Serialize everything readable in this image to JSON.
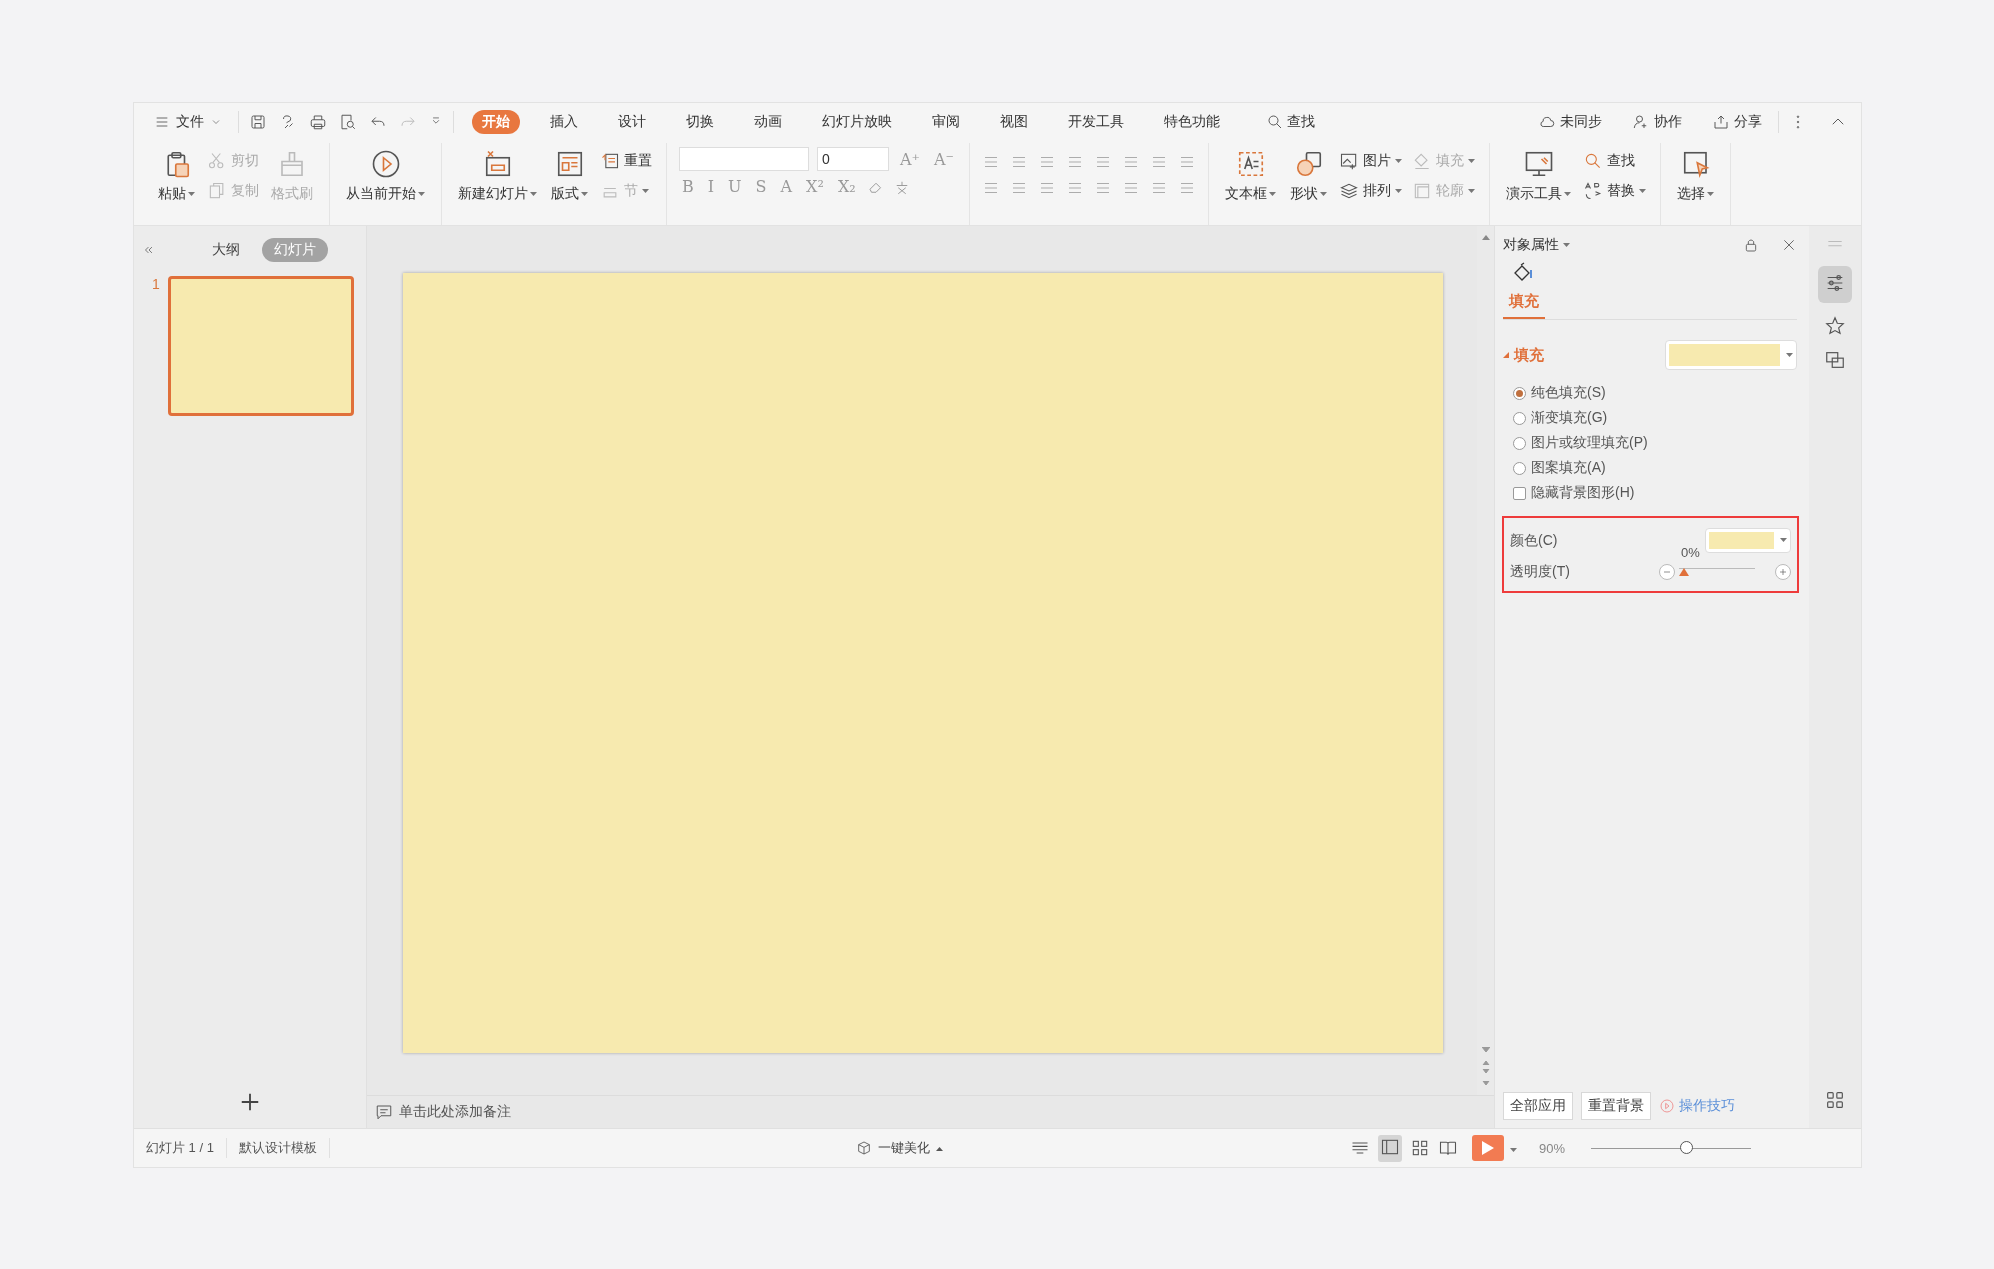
{
  "menu": {
    "label": "文件"
  },
  "tabs": [
    {
      "label": "开始",
      "selected": true
    },
    {
      "label": "插入",
      "selected": false
    },
    {
      "label": "设计",
      "selected": false
    },
    {
      "label": "切换",
      "selected": false
    },
    {
      "label": "动画",
      "selected": false
    },
    {
      "label": "幻灯片放映",
      "selected": false
    },
    {
      "label": "审阅",
      "selected": false
    },
    {
      "label": "视图",
      "selected": false
    },
    {
      "label": "开发工具",
      "selected": false
    },
    {
      "label": "特色功能",
      "selected": false
    }
  ],
  "search": {
    "label": "查找"
  },
  "top_right": [
    {
      "label": "未同步"
    },
    {
      "label": "协作"
    },
    {
      "label": "分享"
    }
  ],
  "ribbon": [
    {
      "kind": "buttons",
      "items": [
        {
          "label": "粘贴",
          "kind": "large",
          "dropdown": true,
          "disabled": false
        },
        {
          "label": "剪切",
          "kind": "small",
          "dropdown": false,
          "disabled": true
        },
        {
          "label": "复制",
          "kind": "small",
          "dropdown": false,
          "disabled": true
        },
        {
          "label": "格式刷",
          "kind": "large",
          "dropdown": false,
          "disabled": true
        }
      ]
    },
    {
      "kind": "buttons",
      "items": [
        {
          "label": "从当前开始",
          "kind": "large",
          "dropdown": true,
          "disabled": false
        }
      ]
    },
    {
      "kind": "buttons",
      "items": [
        {
          "label": "新建幻灯片",
          "kind": "large",
          "dropdown": true,
          "disabled": false
        },
        {
          "label": "版式",
          "kind": "large",
          "dropdown": true,
          "disabled": false
        },
        {
          "label": "重置",
          "kind": "small",
          "dropdown": false,
          "disabled": false
        },
        {
          "label": "节",
          "kind": "small",
          "dropdown": true,
          "disabled": true
        }
      ]
    },
    {
      "kind": "font",
      "size_value": "0",
      "grow": "A⁺",
      "shrink": "A⁻",
      "styles": [
        "B",
        "I",
        "U",
        "S",
        "A",
        "X²",
        "X₂"
      ]
    },
    {
      "kind": "paragraph"
    },
    {
      "kind": "buttons",
      "items": [
        {
          "label": "文本框",
          "kind": "large",
          "dropdown": true,
          "disabled": false
        },
        {
          "label": "形状",
          "kind": "large",
          "dropdown": true,
          "disabled": false
        },
        {
          "label": "图片",
          "kind": "small",
          "dropdown": true,
          "disabled": false
        },
        {
          "label": "排列",
          "kind": "small",
          "dropdown": true,
          "disabled": false
        },
        {
          "label": "填充",
          "kind": "small",
          "dropdown": true,
          "disabled": true
        },
        {
          "label": "轮廓",
          "kind": "small",
          "dropdown": true,
          "disabled": true
        }
      ]
    },
    {
      "kind": "buttons",
      "items": [
        {
          "label": "演示工具",
          "kind": "large",
          "dropdown": true,
          "disabled": false
        },
        {
          "label": "查找",
          "kind": "small",
          "dropdown": false,
          "disabled": false
        },
        {
          "label": "替换",
          "kind": "small",
          "dropdown": true,
          "disabled": false
        }
      ]
    },
    {
      "kind": "buttons",
      "items": [
        {
          "label": "选择",
          "kind": "large",
          "dropdown": true,
          "disabled": false
        }
      ]
    }
  ],
  "left_panel": {
    "tabs": [
      {
        "label": "大纲",
        "selected": false
      },
      {
        "label": "幻灯片",
        "selected": true
      }
    ],
    "slides": [
      {
        "number": "1",
        "selected": true,
        "color": "#f7eaaf"
      }
    ]
  },
  "slide": {
    "color": "#f7eaaf"
  },
  "notes": {
    "placeholder": "单击此处添加备注"
  },
  "properties": {
    "title": "对象属性",
    "tabs": [
      {
        "label": "填充",
        "selected": true
      }
    ],
    "section": {
      "label": "填充",
      "expanded": true,
      "color": "#f7eaaf"
    },
    "options": [
      {
        "kind": "radio",
        "label": "纯色填充(S)",
        "selected": true
      },
      {
        "kind": "radio",
        "label": "渐变填充(G)",
        "selected": false
      },
      {
        "kind": "radio",
        "label": "图片或纹理填充(P)",
        "selected": false
      },
      {
        "kind": "radio",
        "label": "图案填充(A)",
        "selected": false
      },
      {
        "kind": "checkbox",
        "label": "隐藏背景图形(H)",
        "checked": false
      }
    ],
    "color": {
      "label": "颜色(C)",
      "color": "#f7eaaf"
    },
    "transparency": {
      "label": "透明度(T)",
      "reading": "0%",
      "level": 0
    },
    "buttons": [
      {
        "label": "全部应用"
      },
      {
        "label": "重置背景"
      }
    ],
    "tips": {
      "label": "操作技巧"
    }
  },
  "status_bar": {
    "slide_count": "幻灯片 1 / 1",
    "template": "默认设计模板",
    "beautify": "一键美化",
    "zoom": "90%",
    "zoom_slider": {
      "level": 0.6
    }
  }
}
